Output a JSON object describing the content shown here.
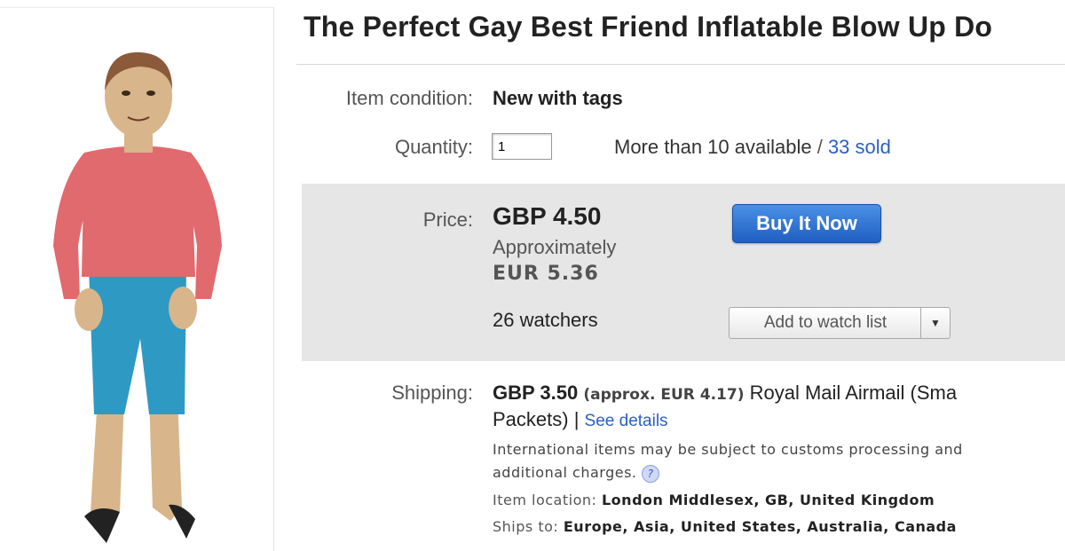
{
  "listing": {
    "title": "The Perfect Gay Best Friend Inflatable Blow Up Do"
  },
  "condition": {
    "label": "Item condition:",
    "value": "New with tags"
  },
  "quantity": {
    "label": "Quantity:",
    "value": "1",
    "available": "More than 10 available",
    "separator": " / ",
    "sold": "33 sold"
  },
  "price": {
    "label": "Price:",
    "value": "GBP 4.50",
    "approx_label": "Approximately",
    "approx_value": "EUR 5.36",
    "watchers": "26 watchers",
    "buy_label": "Buy It Now",
    "watch_label": "Add to watch list"
  },
  "shipping": {
    "label": "Shipping:",
    "cost": "GBP 3.50",
    "approx": "(approx. EUR 4.17)",
    "method_1": "Royal Mail Airmail (Sma",
    "method_2": "Packets) |",
    "details_link": "See details",
    "note_1": "International items may be subject to customs processing and",
    "note_2": "additional charges.",
    "help_glyph": "?",
    "location_label": "Item location:",
    "location_value": "London Middlesex, GB, United Kingdom",
    "ships_to_label": "Ships to:",
    "ships_to_value": "Europe, Asia, United States, Australia, Canada"
  },
  "colors": {
    "accent_link": "#2a5fc4",
    "buy_button": "#2a6fd6",
    "price_box_bg": "#e6e6e6"
  },
  "icons": {
    "dropdown": "chevron-down-icon",
    "help": "help-icon"
  }
}
